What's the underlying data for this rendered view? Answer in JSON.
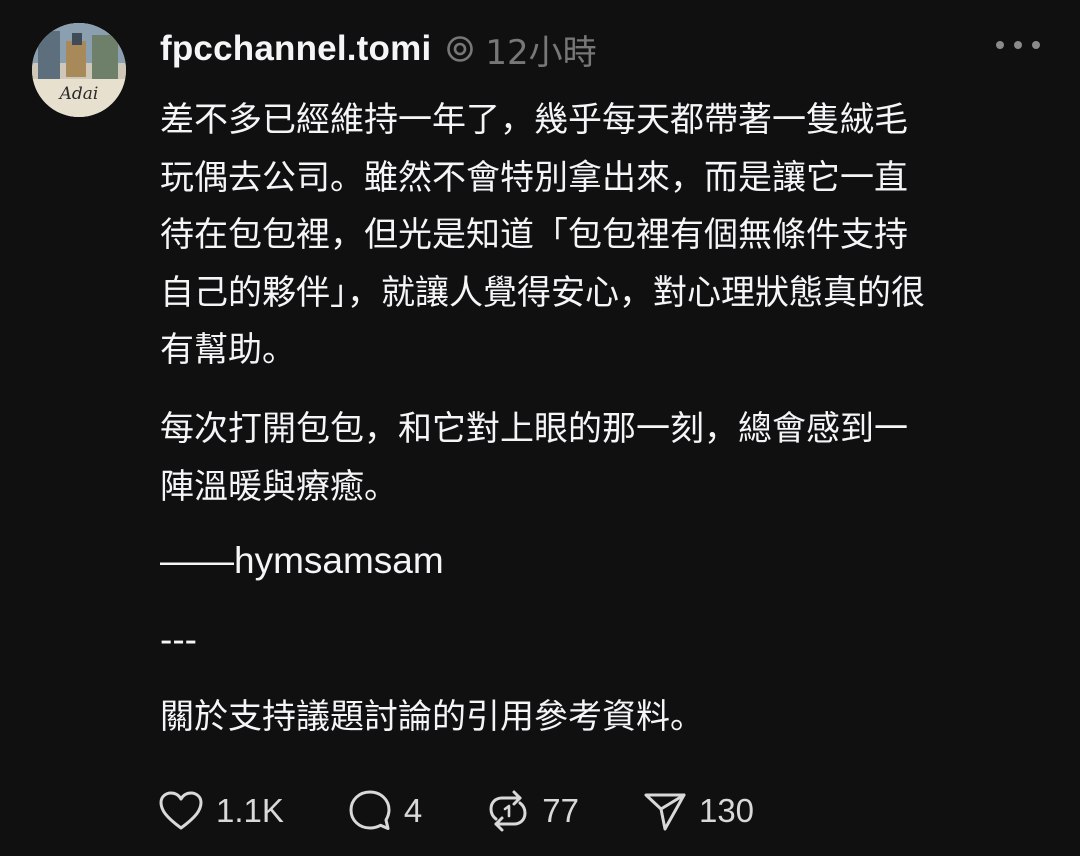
{
  "post": {
    "author": "fpcchannel.tomi",
    "time": "12小時",
    "avatar_text": "Adai",
    "paragraphs": [
      "差不多已經維持一年了，幾乎每天都帶著一隻絨毛\n玩偶去公司。雖然不會特別拿出來，而是讓它一直\n待在包包裡，但光是知道「包包裡有個無條件支持\n自己的夥伴」，就讓人覺得安心，對心理狀態真的很\n有幫助。",
      "每次打開包包，和它對上眼的那一刻，總會感到一\n陣溫暖與療癒。"
    ],
    "signature": "——hymsamsam",
    "separator": "---",
    "closing": "關於支持議題討論的引用參考資料。"
  },
  "actions": {
    "likes": "1.1K",
    "comments": "4",
    "reposts": "77",
    "shares": "130"
  },
  "icons": {
    "like": "heart-icon",
    "comment": "comment-bubble-icon",
    "repost": "repost-icon",
    "share": "send-icon",
    "thread": "threads-logo-icon",
    "more": "more-horizontal-icon"
  },
  "colors": {
    "background": "#101010",
    "text": "#f3f5f7",
    "muted": "#777777"
  }
}
